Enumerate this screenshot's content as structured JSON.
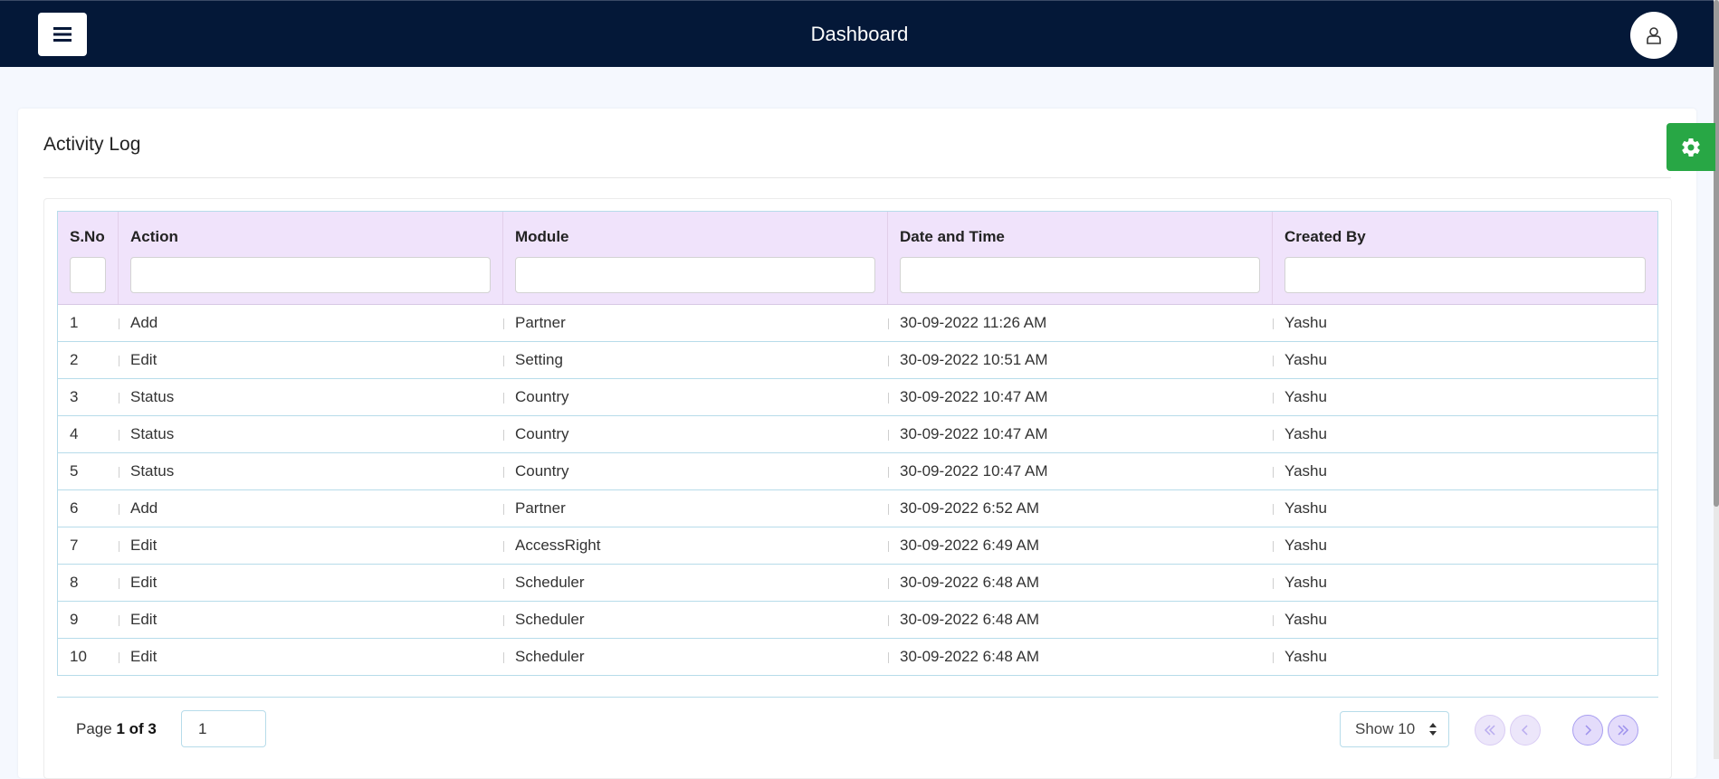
{
  "header": {
    "title": "Dashboard",
    "menu_icon": "hamburger-icon",
    "user_icon": "user-icon",
    "background_color": "#041838"
  },
  "card": {
    "title": "Activity Log"
  },
  "settings": {
    "icon": "gear-icon",
    "color": "#28a745"
  },
  "table": {
    "columns": [
      "S.No",
      "Action",
      "Module",
      "Date and Time",
      "Created By"
    ],
    "filters": [
      "",
      "",
      "",
      "",
      ""
    ],
    "header_color": "#f0e3fb",
    "rows": [
      [
        "1",
        "Add",
        "Partner",
        "30-09-2022 11:26 AM",
        "Yashu"
      ],
      [
        "2",
        "Edit",
        "Setting",
        "30-09-2022 10:51 AM",
        "Yashu"
      ],
      [
        "3",
        "Status",
        "Country",
        "30-09-2022 10:47 AM",
        "Yashu"
      ],
      [
        "4",
        "Status",
        "Country",
        "30-09-2022 10:47 AM",
        "Yashu"
      ],
      [
        "5",
        "Status",
        "Country",
        "30-09-2022 10:47 AM",
        "Yashu"
      ],
      [
        "6",
        "Add",
        "Partner",
        "30-09-2022 6:52 AM",
        "Yashu"
      ],
      [
        "7",
        "Edit",
        "AccessRight",
        "30-09-2022 6:49 AM",
        "Yashu"
      ],
      [
        "8",
        "Edit",
        "Scheduler",
        "30-09-2022 6:48 AM",
        "Yashu"
      ],
      [
        "9",
        "Edit",
        "Scheduler",
        "30-09-2022 6:48 AM",
        "Yashu"
      ],
      [
        "10",
        "Edit",
        "Scheduler",
        "30-09-2022 6:48 AM",
        "Yashu"
      ]
    ]
  },
  "pagination": {
    "page_prefix": "Page",
    "page_current_of_total": "1 of 3",
    "page_input_value": "1",
    "show_label": "Show 10",
    "first_icon": "double-chevron-left-icon",
    "prev_icon": "chevron-left-icon",
    "next_icon": "chevron-right-icon",
    "last_icon": "double-chevron-right-icon"
  }
}
